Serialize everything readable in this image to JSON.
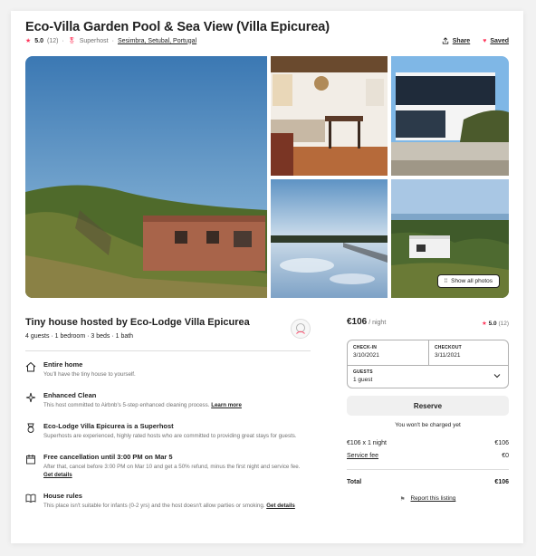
{
  "listing": {
    "title": "Eco-Villa Garden Pool & Sea View (Villa Epicurea)",
    "rating": "5.0",
    "reviews": "(12)",
    "superhost": "Superhost",
    "location": "Sesimbra, Setubal, Portugal",
    "share_label": "Share",
    "saved_label": "Saved",
    "show_all_photos": "Show all photos"
  },
  "host": {
    "title": "Tiny house hosted by Eco-Lodge Villa Epicurea",
    "summary": "4 guests · 1 bedroom · 3 beds · 1 bath"
  },
  "features": [
    {
      "icon": "home-icon",
      "title": "Entire home",
      "desc": "You'll have the tiny house to yourself.",
      "link": ""
    },
    {
      "icon": "sparkle-icon",
      "title": "Enhanced Clean",
      "desc": "This host committed to Airbnb's 5-step enhanced cleaning process.",
      "link": "Learn more"
    },
    {
      "icon": "medal-icon",
      "title": "Eco-Lodge Villa Epicurea is a Superhost",
      "desc": "Superhosts are experienced, highly rated hosts who are committed to providing great stays for guests.",
      "link": ""
    },
    {
      "icon": "calendar-icon",
      "title": "Free cancellation until 3:00 PM on Mar 5",
      "desc": "After that, cancel before 3:00 PM on Mar 10 and get a 50% refund, minus the first night and service fee.",
      "link": "Get details"
    },
    {
      "icon": "book-icon",
      "title": "House rules",
      "desc": "This place isn't suitable for infants (0-2 yrs) and the host doesn't allow parties or smoking.",
      "link": "Get details"
    }
  ],
  "booking": {
    "price": "€106",
    "per": " / night",
    "rating": "5.0",
    "reviews": "(12)",
    "checkin_label": "CHECK-IN",
    "checkin_value": "3/10/2021",
    "checkout_label": "CHECKOUT",
    "checkout_value": "3/11/2021",
    "guests_label": "GUESTS",
    "guests_value": "1 guest",
    "reserve_label": "Reserve",
    "note": "You won't be charged yet",
    "nightly_label": "€106 x 1 night",
    "nightly_value": "€106",
    "fee_label": "Service fee",
    "fee_value": "€0",
    "total_label": "Total",
    "total_value": "€106",
    "report_label": "Report this listing"
  },
  "colors": {
    "accent": "#ff385c",
    "text": "#222222",
    "muted": "#717171",
    "border": "#dddddd"
  }
}
